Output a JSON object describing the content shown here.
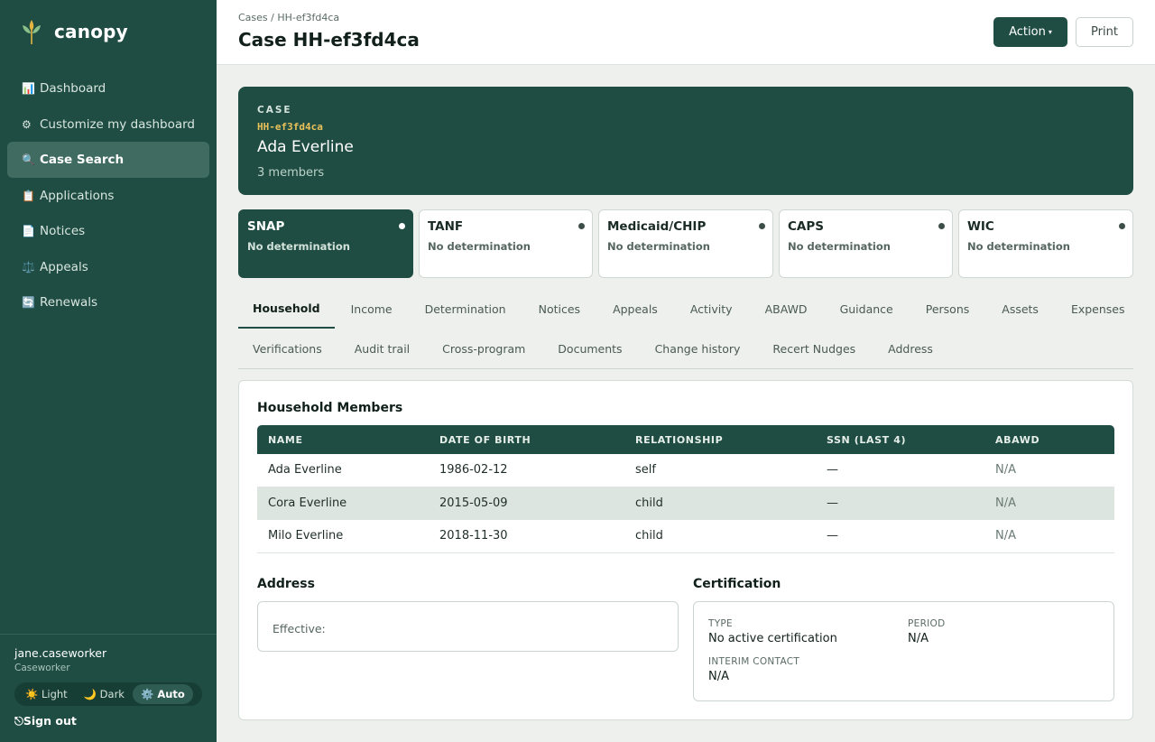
{
  "sidebar": {
    "brand": "canopy",
    "items": [
      {
        "icon": "📊",
        "label": "Dashboard"
      },
      {
        "icon": "⚙",
        "label": "Customize my dashboard"
      },
      {
        "icon": "🔍",
        "label": "Case Search"
      },
      {
        "icon": "📋",
        "label": "Applications"
      },
      {
        "icon": "📄",
        "label": "Notices"
      },
      {
        "icon": "⚖️",
        "label": "Appeals"
      },
      {
        "icon": "🔄",
        "label": "Renewals"
      }
    ],
    "active_item": "Case Search",
    "user": {
      "name": "jane.caseworker",
      "role": "Caseworker"
    },
    "theme": {
      "options": [
        {
          "icon": "☀️",
          "label": "Light"
        },
        {
          "icon": "🌙",
          "label": "Dark"
        },
        {
          "icon": "⚙️",
          "label": "Auto"
        }
      ],
      "selected": "Auto"
    },
    "signout": {
      "icon": "⎋",
      "label": "Sign out"
    }
  },
  "header": {
    "breadcrumb": "Cases / HH-ef3fd4ca",
    "title": "Case HH-ef3fd4ca",
    "action_label": "Action",
    "action_caret": "▾",
    "print_label": "Print"
  },
  "case": {
    "label": "CASE",
    "id": "HH-ef3fd4ca",
    "name": "Ada Everline",
    "members": "3 members"
  },
  "programs": [
    {
      "name": "SNAP",
      "status": "No determination"
    },
    {
      "name": "TANF",
      "status": "No determination"
    },
    {
      "name": "Medicaid/CHIP",
      "status": "No determination"
    },
    {
      "name": "CAPS",
      "status": "No determination"
    },
    {
      "name": "WIC",
      "status": "No determination"
    }
  ],
  "selected_program": "SNAP",
  "tabs": {
    "row1": [
      "Household",
      "Income",
      "Determination",
      "Notices",
      "Appeals",
      "Activity",
      "ABAWD",
      "Guidance",
      "Persons",
      "Assets",
      "Expenses"
    ],
    "row2": [
      "Verifications",
      "Audit trail",
      "Cross-program",
      "Documents",
      "Change history",
      "Recert Nudges",
      "Address"
    ],
    "active": "Household"
  },
  "household": {
    "title": "Household Members",
    "columns": [
      "NAME",
      "DATE OF BIRTH",
      "RELATIONSHIP",
      "SSN (LAST 4)",
      "ABAWD"
    ],
    "rows": [
      [
        "Ada Everline",
        "1986-02-12",
        "self",
        "—",
        "N/A"
      ],
      [
        "Cora Everline",
        "2015-05-09",
        "child",
        "—",
        "N/A"
      ],
      [
        "Milo Everline",
        "2018-11-30",
        "child",
        "—",
        "N/A"
      ]
    ]
  },
  "address": {
    "title": "Address",
    "effective_label": "Effective:"
  },
  "certification": {
    "title": "Certification",
    "type_label": "TYPE",
    "type_value": "No active certification",
    "period_label": "PERIOD",
    "period_value": "N/A",
    "interim_label": "INTERIM CONTACT",
    "interim_value": "N/A"
  },
  "colors": {
    "brand": "#1f4d43",
    "case_id": "#e8c15a"
  }
}
